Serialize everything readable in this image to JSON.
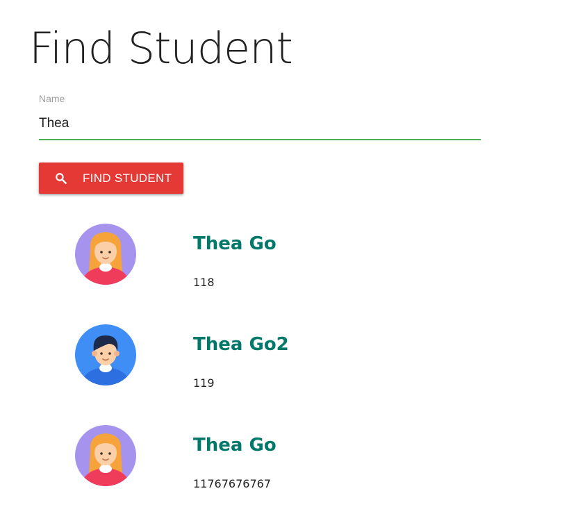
{
  "page": {
    "title": "Find Student"
  },
  "search": {
    "label": "Name",
    "value": "Thea",
    "button_label": "FIND STUDENT"
  },
  "students": [
    {
      "name": "Thea Go",
      "id": "118",
      "avatar": "female-avatar-icon"
    },
    {
      "name": "Thea Go2",
      "id": "119",
      "avatar": "male-avatar-icon"
    },
    {
      "name": "Thea Go",
      "id": "11767676767",
      "avatar": "female-avatar-icon"
    }
  ],
  "colors": {
    "title_text": "#212121",
    "input_underline": "#4caf50",
    "button_bg": "#e53935",
    "student_name": "#00796b",
    "female_avatar_bg": "#a593ee",
    "male_avatar_bg": "#3f8ef6"
  }
}
